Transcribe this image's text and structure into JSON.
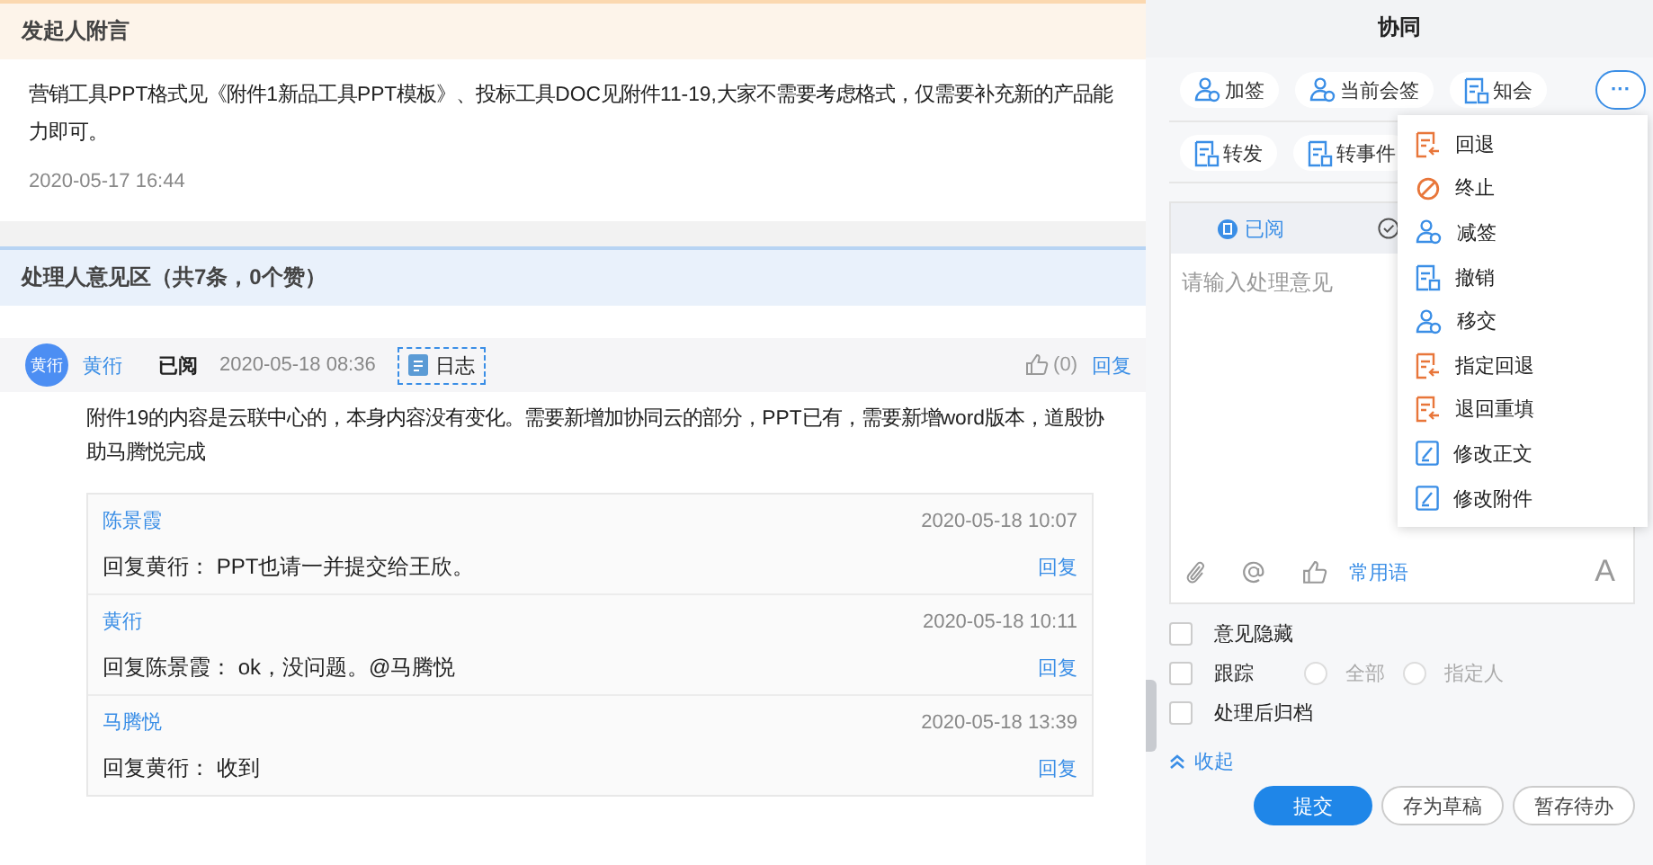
{
  "initiator_note": {
    "title": "发起人附言",
    "text": "营销工具PPT格式见《附件1新品工具PPT模板》、投标工具DOC见附件11-19,大家不需要考虑格式，仅需要补充新的产品能力即可。",
    "time": "2020-05-17 16:44"
  },
  "opinions": {
    "title": "处理人意见区（共7条，0个赞）",
    "entries": [
      {
        "avatar": "黄衎",
        "name": "黄衎",
        "attitude": "已阅",
        "time": "2020-05-18 08:36",
        "tag": "日志",
        "likes": "(0)",
        "reply": "回复",
        "text": "附件19的内容是云联中心的，本身内容没有变化。需要新增加协同云的部分，PPT已有，需要新增word版本，道殷协助马腾悦完成",
        "replies": [
          {
            "name": "陈景霞",
            "time": "2020-05-18 10:07",
            "text": "回复黄衎：  PPT也请一并提交给王欣。",
            "reply": "回复"
          },
          {
            "name": "黄衎",
            "time": "2020-05-18 10:11",
            "text": "回复陈景霞：  ok，没问题。@马腾悦",
            "reply": "回复"
          },
          {
            "name": "马腾悦",
            "time": "2020-05-18 13:39",
            "text": "回复黄衎：  收到",
            "reply": "回复"
          }
        ]
      }
    ]
  },
  "panel": {
    "title": "协同",
    "actions_row1": [
      {
        "label": "加签",
        "kind": "person"
      },
      {
        "label": "当前会签",
        "kind": "person"
      },
      {
        "label": "知会",
        "kind": "doc"
      }
    ],
    "more_button": "···",
    "actions_row2": [
      {
        "label": "转发",
        "kind": "doc"
      },
      {
        "label": "转事件",
        "kind": "doc"
      }
    ],
    "attitude_tabs": [
      {
        "label": "已阅",
        "selected": true
      }
    ],
    "comment": {
      "placeholder": "请输入处理意见",
      "common_phrases": "常用语",
      "font_button": "A"
    },
    "options": [
      {
        "label": "意见隐藏",
        "checked": false
      },
      {
        "label": "跟踪",
        "checked": false,
        "radios": [
          {
            "label": "全部",
            "selected": false,
            "disabled": true
          },
          {
            "label": "指定人",
            "selected": false,
            "disabled": true
          }
        ]
      },
      {
        "label": "处理后归档",
        "checked": false
      }
    ],
    "collapse": "收起",
    "buttons": [
      {
        "label": "提交",
        "kind": "primary"
      },
      {
        "label": "存为草稿",
        "kind": "default"
      },
      {
        "label": "暂存待办",
        "kind": "default"
      }
    ],
    "menu": [
      {
        "label": "回退",
        "kind": "return"
      },
      {
        "label": "终止",
        "kind": "stop"
      },
      {
        "label": "减签",
        "kind": "person"
      },
      {
        "label": "撤销",
        "kind": "doc"
      },
      {
        "label": "移交",
        "kind": "person"
      },
      {
        "label": "指定回退",
        "kind": "return"
      },
      {
        "label": "退回重填",
        "kind": "return"
      },
      {
        "label": "修改正文",
        "kind": "edit"
      },
      {
        "label": "修改附件",
        "kind": "edit"
      }
    ]
  }
}
